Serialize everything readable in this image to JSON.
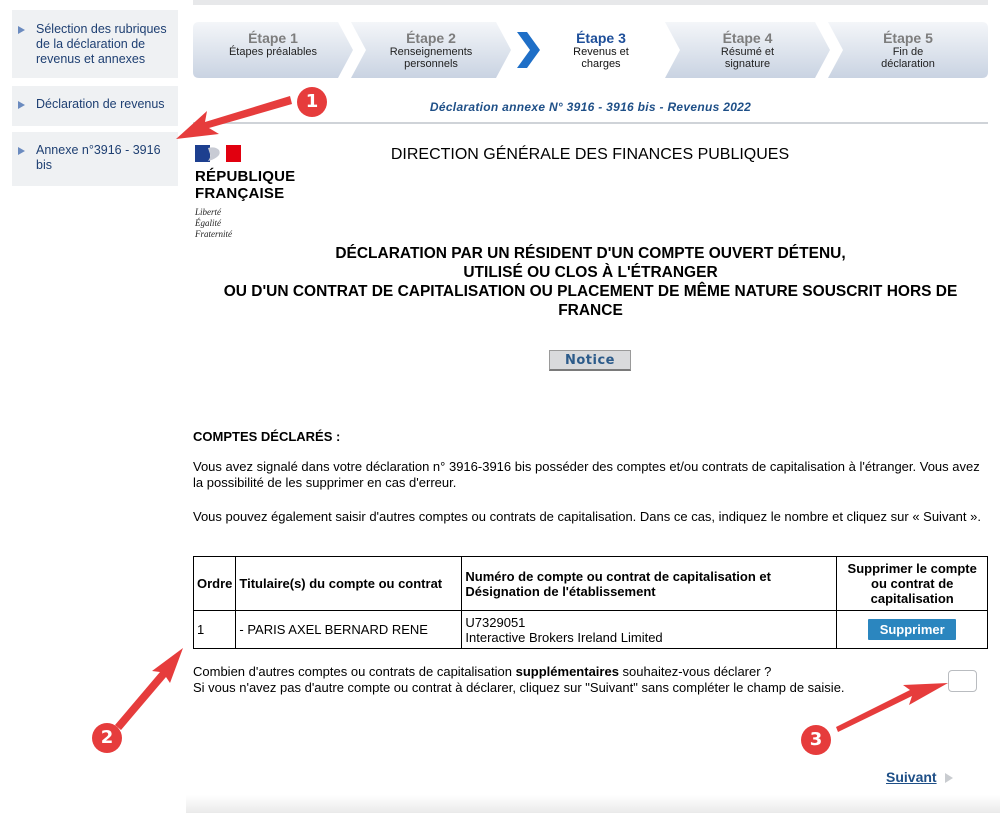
{
  "sidebar": {
    "items": [
      {
        "label": "Sélection des rubriques de la déclaration de revenus et annexes"
      },
      {
        "label": "Déclaration de revenus"
      },
      {
        "label": "Annexe n°3916 - 3916 bis"
      }
    ]
  },
  "stepper": {
    "steps": [
      {
        "title": "Étape 1",
        "subtitle": "Étapes préalables"
      },
      {
        "title": "Étape 2",
        "subtitle": "Renseignements personnels"
      },
      {
        "title": "Étape 3",
        "subtitle": "Revenus et charges"
      },
      {
        "title": "Étape 4",
        "subtitle": "Résumé et signature"
      },
      {
        "title": "Étape 5",
        "subtitle": "Fin de déclaration"
      }
    ],
    "active_index": 2
  },
  "annexe_title": "Déclaration annexe N° 3916 - 3916 bis - Revenus 2022",
  "logo": {
    "line1": "RÉPUBLIQUE",
    "line2": "FRANÇAISE",
    "motto1": "Liberté",
    "motto2": "Égalité",
    "motto3": "Fraternité"
  },
  "header_org": "DIRECTION GÉNÉRALE DES FINANCES PUBLIQUES",
  "main_title": {
    "line1": "DÉCLARATION PAR UN RÉSIDENT D'UN COMPTE OUVERT DÉTENU,",
    "line2": "UTILISÉ OU CLOS À L'ÉTRANGER",
    "line3": "OU D'UN CONTRAT DE CAPITALISATION OU PLACEMENT DE MÊME NATURE SOUSCRIT HORS DE FRANCE"
  },
  "notice_label": "Notice",
  "section_title": "COMPTES DÉCLARÉS :",
  "para1": "Vous avez signalé dans votre déclaration n° 3916-3916 bis posséder des comptes et/ou contrats de capitalisation à l'étranger. Vous avez la possibilité de les supprimer en cas d'erreur.",
  "para2": "Vous pouvez également saisir d'autres comptes ou contrats de capitalisation. Dans ce cas, indiquez le nombre et cliquez sur « Suivant ».",
  "table": {
    "headers": {
      "order": "Ordre",
      "holder": "Titulaire(s) du compte ou contrat",
      "number": "Numéro de compte ou contrat de capitalisation et Désignation de l'établissement",
      "delete": "Supprimer le compte ou contrat de capitalisation"
    },
    "rows": [
      {
        "order": "1",
        "holder": "- PARIS AXEL BERNARD RENE",
        "account_number": "U7329051",
        "institution": "Interactive Brokers Ireland Limited",
        "delete_label": "Supprimer"
      }
    ]
  },
  "question": {
    "prefix": "Combien d'autres comptes ou contrats de capitalisation ",
    "bold": "supplémentaires",
    "suffix": " souhaitez-vous déclarer ?",
    "hint": "Si vous n'avez pas d'autre compte ou contrat à déclarer, cliquez sur \"Suivant\" sans compléter le champ de saisie.",
    "input_value": ""
  },
  "next_label": "Suivant",
  "annotations": {
    "badge1": "1",
    "badge2": "2",
    "badge3": "3",
    "color": "#e63c3c"
  }
}
